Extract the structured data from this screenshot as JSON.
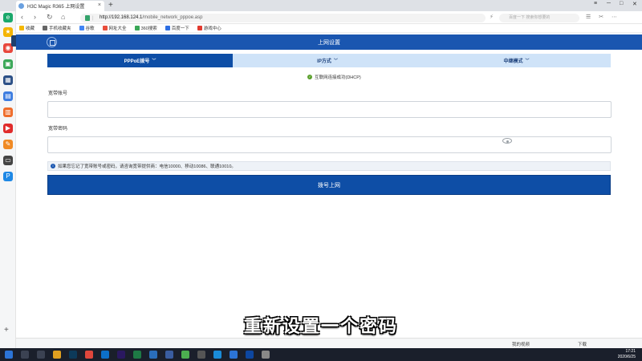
{
  "browser": {
    "tab_title": "H3C Magic R365 上网设置",
    "url_host": "http://192.168.124.1",
    "url_path": "/mobile_network_pppoe.asp",
    "search_placeholder": "百度一下 搜索你想要的",
    "new_tab": "+",
    "bookmarks": [
      {
        "label": "收藏",
        "color": "#f5b800"
      },
      {
        "label": "手机收藏夹",
        "color": "#666666"
      },
      {
        "label": "谷歌",
        "color": "#4285f4"
      },
      {
        "label": "网址大全",
        "color": "#e94e3c"
      },
      {
        "label": "360搜索",
        "color": "#3aa757"
      },
      {
        "label": "百度一下",
        "color": "#2d6ee3"
      },
      {
        "label": "游戏中心",
        "color": "#e23a2f"
      }
    ]
  },
  "page": {
    "title": "上网设置",
    "tabs": [
      {
        "label": "PPPoE拨号",
        "active": true
      },
      {
        "label": "IP方式",
        "active": false
      },
      {
        "label": "中继模式",
        "active": false
      }
    ],
    "auto_detect_label": "互联网连接成功(DHCP)",
    "account_label": "宽带账号",
    "account_value": "",
    "password_label": "宽带密码",
    "password_value": "",
    "info_text": "如果您忘记了宽带账号或密码，请咨询宽带提供商：电信10000、移动10086、联通10010。",
    "dial_button": "拨号上网"
  },
  "subtitle": "重新设置一个密码",
  "status_bar": {
    "left_label": "我的视频",
    "right_label": "下载"
  },
  "taskbar": {
    "time": "17:21",
    "date": "2020/6/25"
  },
  "colors": {
    "header_blue": "#1a56b0",
    "tab_active": "#0e4ea6",
    "tab_bg": "#cfe3f8",
    "button_blue": "#0e4ea6"
  }
}
